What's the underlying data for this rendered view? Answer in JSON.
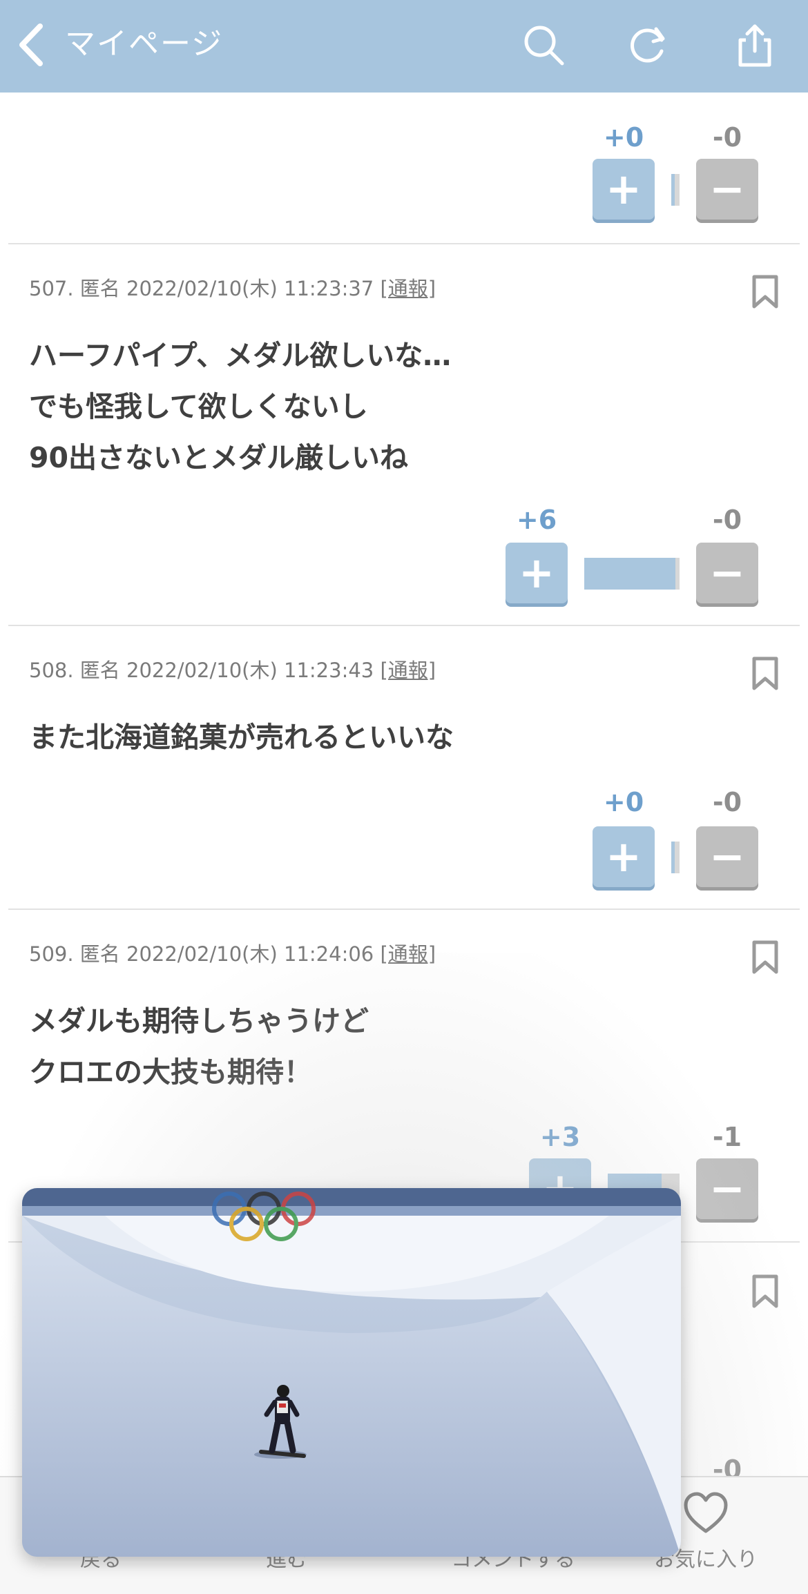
{
  "header": {
    "back_icon": "chevron-left-icon",
    "title": "マイページ",
    "search_icon": "search-icon",
    "refresh_icon": "refresh-icon",
    "share_icon": "share-icon",
    "bg_color": "#a7c5de"
  },
  "comments": [
    {
      "meta": "",
      "body": [],
      "plus_label": "+0",
      "minus_label": "-0",
      "plus_ratio": 0.0
    },
    {
      "meta": "507. 匿名 2022/02/10(木) 11:23:37 ",
      "report": "[通報]",
      "body": [
        "ハーフパイプ、メダル欲しいな…",
        "でも怪我して欲しくないし",
        "90出さないとメダル厳しいね"
      ],
      "plus_label": "+6",
      "minus_label": "-0",
      "plus_ratio": 1.0
    },
    {
      "meta": "508. 匿名 2022/02/10(木) 11:23:43 ",
      "report": "[通報]",
      "body": [
        "また北海道銘菓が売れるといいな"
      ],
      "plus_label": "+0",
      "minus_label": "-0",
      "plus_ratio": 0.0
    },
    {
      "meta": "509. 匿名 2022/02/10(木) 11:24:06 ",
      "report": "[通報]",
      "body": [
        "メダルも期待しちゃうけど",
        "クロエの大技も期待！"
      ],
      "plus_label": "+3",
      "minus_label": "-1",
      "plus_ratio": 0.75
    },
    {
      "minus_label": "-0"
    }
  ],
  "vote": {
    "plus_symbol": "+",
    "minus_symbol": "−",
    "plus_color": "#a9c6de",
    "minus_color": "#bfbfbf"
  },
  "toolbar": {
    "back_label": "戻る",
    "forward_label": "進む",
    "comment_label": "コメントする",
    "favorite_label": "お気に入り",
    "favorite_icon": "heart-icon"
  },
  "video": {
    "scene": "snowboard-halfpipe"
  }
}
